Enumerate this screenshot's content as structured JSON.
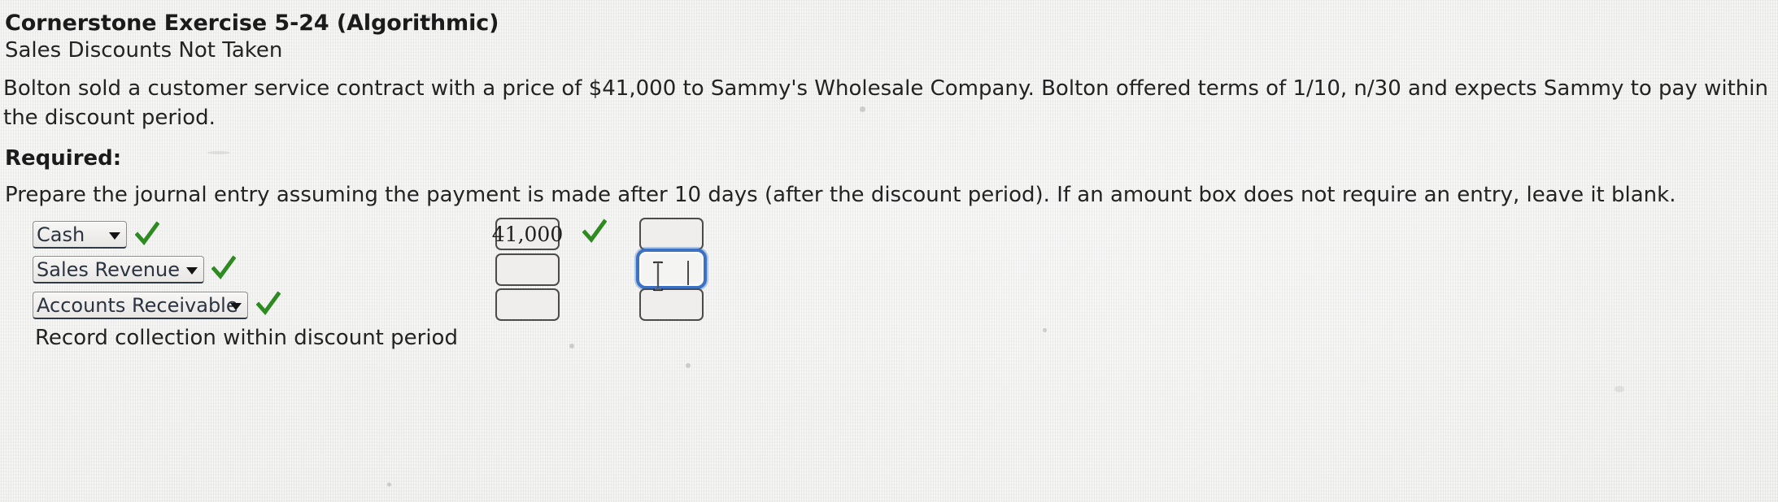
{
  "document": {
    "title": "Cornerstone Exercise 5-24 (Algorithmic)",
    "subtitle": "Sales Discounts Not Taken",
    "paragraph_line_1": "Bolton sold a customer service contract with a price of $41,000 to Sammy's Wholesale Company. Bolton offered terms of 1/10, n/30 and expects Sammy to pay within",
    "paragraph_line_2": "the discount period.",
    "required_label": "Required:",
    "instruction": "Prepare the journal entry assuming the payment is made after 10 days (after the discount period). If an amount box does not require an entry, leave it blank.",
    "caption": "Record collection within discount period"
  },
  "journal_entry": {
    "rows": [
      {
        "account": "Cash",
        "account_correct_mark": "check-icon",
        "debit": "41,000",
        "debit_correct_mark": "check-icon",
        "credit": ""
      },
      {
        "account": "Sales Revenue",
        "account_correct_mark": "check-icon",
        "debit": "",
        "debit_correct_mark": "",
        "credit": ""
      },
      {
        "account": "Accounts Receivable",
        "account_correct_mark": "check-icon",
        "debit": "",
        "debit_correct_mark": "",
        "credit": ""
      }
    ],
    "focused_field": "row-2-credit"
  },
  "colors": {
    "page_background": "#ebebe9",
    "text": "#232323",
    "check_green": "#2e8b22",
    "focus_blue": "#3c72c4",
    "select_border": "#8d8d8d",
    "amount_border": "#4b4b4b"
  },
  "icons": {
    "dropdown_arrow": "chevron-down-icon",
    "correct": "check-icon",
    "text_cursor": "i-beam-cursor-icon"
  }
}
